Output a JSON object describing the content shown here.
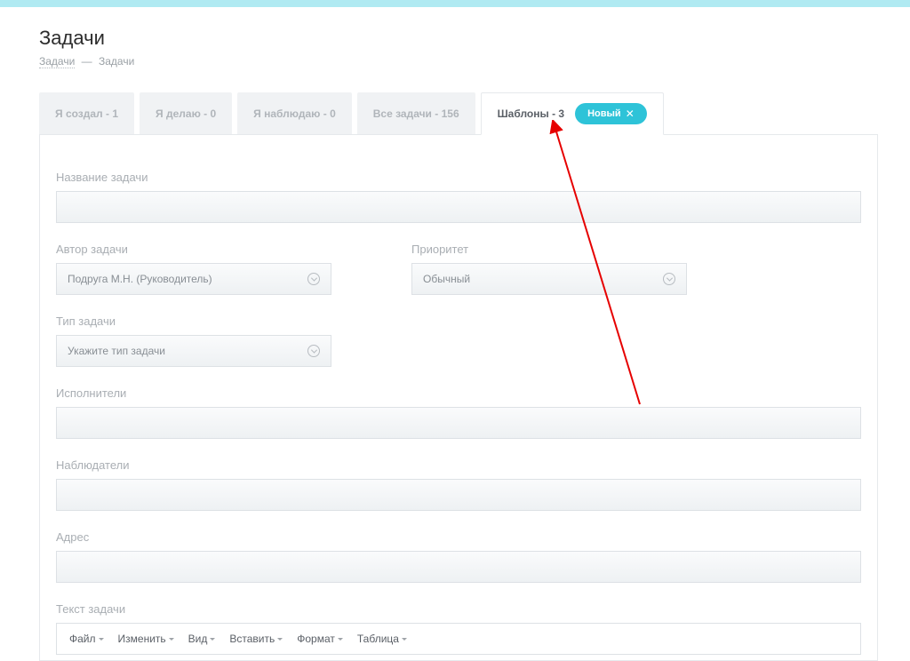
{
  "pageTitle": "Задачи",
  "breadcrumb": {
    "link": "Задачи",
    "sep": "—",
    "current": "Задачи"
  },
  "tabs": {
    "created": "Я создал - 1",
    "doing": "Я делаю - 0",
    "watching": "Я наблюдаю - 0",
    "all": "Все задачи - 156",
    "templates": "Шаблоны - 3"
  },
  "newButton": "Новый",
  "form": {
    "title_label": "Название задачи",
    "author_label": "Автор задачи",
    "author_value": "Подруга М.Н. (Руководитель)",
    "priority_label": "Приоритет",
    "priority_value": "Обычный",
    "type_label": "Тип задачи",
    "type_value": "Укажите тип задачи",
    "executors_label": "Исполнители",
    "observers_label": "Наблюдатели",
    "address_label": "Адрес",
    "text_label": "Текст задачи"
  },
  "editor": {
    "file": "Файл",
    "edit": "Изменить",
    "view": "Вид",
    "insert": "Вставить",
    "format": "Формат",
    "table": "Таблица"
  }
}
